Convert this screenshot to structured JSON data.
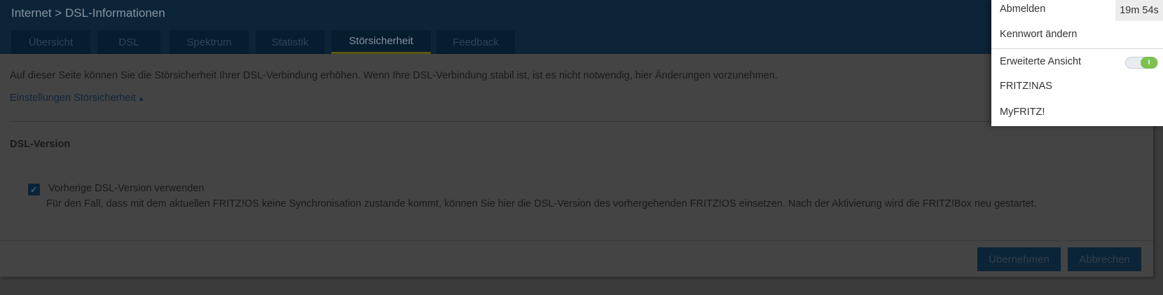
{
  "header": {
    "breadcrumb": "Internet > DSL-Informationen"
  },
  "tabs": [
    {
      "label": "Übersicht"
    },
    {
      "label": "DSL"
    },
    {
      "label": "Spektrum"
    },
    {
      "label": "Statistik"
    },
    {
      "label": "Störsicherheit",
      "active": true
    },
    {
      "label": "Feedback"
    }
  ],
  "content": {
    "intro": "Auf dieser Seite können Sie die Störsicherheit Ihrer DSL-Verbindung erhöhen. Wenn Ihre DSL-Verbindung stabil ist, ist es nicht notwendig, hier Änderungen vorzunehmen.",
    "settings_link": "Einstellungen Störsicherheit",
    "section_title": "DSL-Version",
    "checkbox_label": "Vorherige DSL-Version verwenden",
    "checkbox_checked": true,
    "description": "Für den Fall, dass mit dem aktuellen FRITZ!OS keine Synchronisation zustande kommt, können Sie hier die DSL-Version des vorhergehenden FRITZ!OS einsetzen. Nach der Aktivierung wird die FRITZ!Box neu gestartet."
  },
  "buttons": {
    "apply": "Übernehmen",
    "cancel": "Abbrechen"
  },
  "menu": {
    "logout": "Abmelden",
    "timer": "19m 54s",
    "change_password": "Kennwort ändern",
    "advanced_view": "Erweiterte Ansicht",
    "advanced_view_on": true,
    "toggle_glyph": "I",
    "nas": "FRITZ!NAS",
    "myfritz": "MyFRITZ!"
  },
  "colors": {
    "header": "#0c2438",
    "accent": "#7cc24e"
  }
}
